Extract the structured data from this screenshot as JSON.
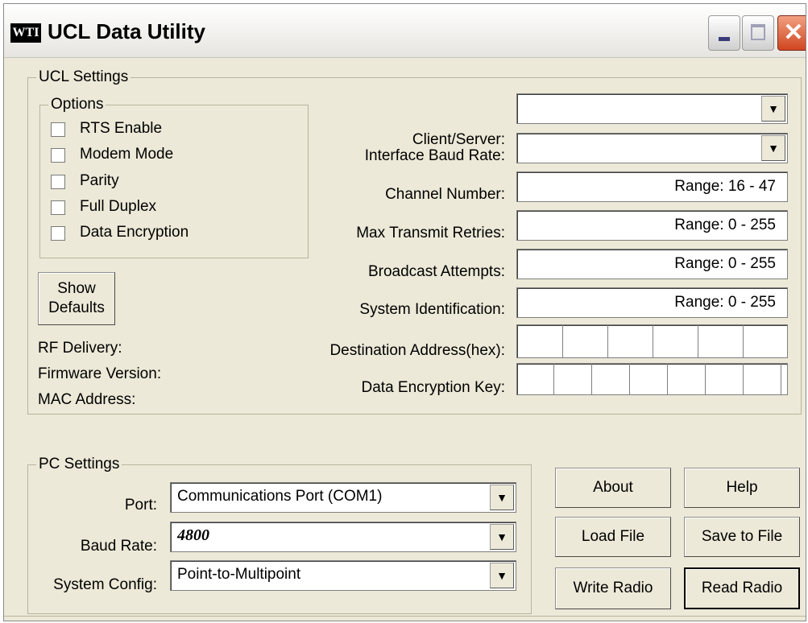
{
  "window": {
    "title": "UCL Data Utility",
    "icon_text": "WTI",
    "close_glyph": "✕"
  },
  "ucl_settings": {
    "legend": "UCL Settings",
    "options": {
      "legend": "Options",
      "items": [
        {
          "label": "RTS Enable",
          "checked": false
        },
        {
          "label": "Modem Mode",
          "checked": false
        },
        {
          "label": "Parity",
          "checked": false
        },
        {
          "label": "Full Duplex",
          "checked": false
        },
        {
          "label": "Data Encryption",
          "checked": false
        }
      ]
    },
    "show_defaults": {
      "line1": "Show",
      "line2": "Defaults"
    },
    "info_labels": {
      "rf_delivery": "RF Delivery:",
      "firmware_version": "Firmware Version:",
      "mac_address": "MAC Address:"
    },
    "fields": {
      "client_server": {
        "label": "Client/Server:",
        "value": ""
      },
      "interface_baud_rate": {
        "label": "Interface Baud Rate:",
        "value": ""
      },
      "channel_number": {
        "label": "Channel Number:",
        "placeholder": "Range: 16 - 47"
      },
      "max_transmit_retries": {
        "label": "Max Transmit Retries:",
        "placeholder": "Range: 0 - 255"
      },
      "broadcast_attempts": {
        "label": "Broadcast Attempts:",
        "placeholder": "Range: 0 - 255"
      },
      "system_identification": {
        "label": "System Identification:",
        "placeholder": "Range: 0 - 255"
      },
      "destination_address": {
        "label": "Destination Address(hex):"
      },
      "data_encryption_key": {
        "label": "Data Encryption Key:"
      }
    }
  },
  "pc_settings": {
    "legend": "PC Settings",
    "port": {
      "label": "Port:",
      "value": "Communications Port (COM1)"
    },
    "baud_rate": {
      "label": "Baud Rate:",
      "value": "4800"
    },
    "system_config": {
      "label": "System Config:",
      "value": "Point-to-Multipoint"
    }
  },
  "buttons": {
    "about": "About",
    "help": "Help",
    "load_file": "Load File",
    "save_to_file": "Save to File",
    "write_radio": "Write Radio",
    "read_radio": "Read Radio"
  },
  "icons": {
    "dropdown_arrow": "▼"
  }
}
